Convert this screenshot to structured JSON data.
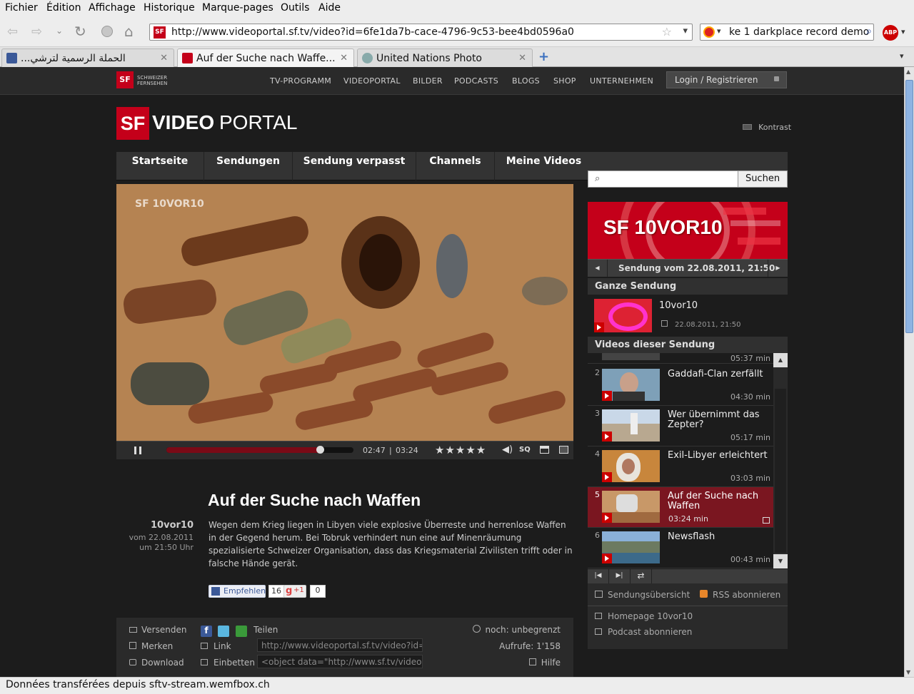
{
  "menu": [
    "Fichier",
    "Édition",
    "Affichage",
    "Historique",
    "Marque-pages",
    "Outils",
    "Aide"
  ],
  "urlbar": {
    "url": "http://www.videoportal.sf.tv/video?id=6fe1da7b-cace-4796-9c53-bee4bd0596a0"
  },
  "searchbar": {
    "value": "ke 1 darkplace record demo"
  },
  "tabs": [
    {
      "label": "الحملة الرسمية لترشي..."
    },
    {
      "label": "Auf der Suche nach Waffe..."
    },
    {
      "label": "United Nations Photo"
    }
  ],
  "site": {
    "logo_small_line1": "SCHWEIZER",
    "logo_small_line2": "FERNSEHEN",
    "topnav": [
      "TV-PROGRAMM",
      "VIDEOPORTAL",
      "BILDER",
      "PODCASTS",
      "BLOGS",
      "SHOP",
      "UNTERNEHMEN"
    ],
    "login": "Login / Registrieren",
    "logo_sf": "SF",
    "logo_video": "VIDEO",
    "logo_portal": "PORTAL",
    "kontrast": "Kontrast",
    "mainnav": [
      "Startseite",
      "Sendungen",
      "Sendung verpasst",
      "Channels",
      "Meine Videos"
    ],
    "search_button": "Suchen"
  },
  "player": {
    "overlay_logo": "SF 10VOR10",
    "time_current": "02:47",
    "time_sep": "|",
    "time_total": "03:24",
    "progress": 0.82,
    "stars": "★★★★★",
    "sq": "SQ"
  },
  "article": {
    "title": "Auf der Suche nach Waffen",
    "show": "10vor10",
    "date_line": "vom 22.08.2011",
    "time_line": "um 21:50 Uhr",
    "body": "Wegen dem Krieg liegen in Libyen viele explosive Überreste und herrenlose Waffen in der Gegend herum. Bei Tobruk  verhindert nun eine auf Minenräumung spezialisierte Schweizer Organisation, dass das Kriegsmaterial Zivilisten trifft oder in falsche Hände gerät.",
    "empfehlen": "Empfehlen",
    "empfehlen_count": "16",
    "gplus": "+1",
    "gplus_count": "0"
  },
  "actions": {
    "versenden": "Versenden",
    "merken": "Merken",
    "download": "Download",
    "teilen": "Teilen",
    "link": "Link",
    "einbetten": "Einbetten",
    "link_value": "http://www.videoportal.sf.tv/video?id=",
    "embed_value": "<object data=\"http://www.sf.tv/video",
    "noch": "noch: unbegrenzt",
    "aufrufe": "Aufrufe: 1'158",
    "hilfe": "Hilfe"
  },
  "sidebar": {
    "banner": "SF 10VOR10",
    "sendung": "Sendung vom 22.08.2011, 21:50",
    "ganze_sendung": "Ganze Sendung",
    "full_title": "10vor10",
    "full_date": "22.08.2011, 21:50",
    "videos_header": "Videos dieser Sendung",
    "partial_duration": "05:37 min",
    "items": [
      {
        "num": "2",
        "title": "Gaddafi-Clan zerfällt",
        "duration": "04:30 min"
      },
      {
        "num": "3",
        "title": "Wer übernimmt das Zepter?",
        "duration": "05:17 min"
      },
      {
        "num": "4",
        "title": "Exil-Libyer erleichtert",
        "duration": "03:03 min"
      },
      {
        "num": "5",
        "title": "Auf der Suche nach Waffen",
        "duration": "03:24 min"
      },
      {
        "num": "6",
        "title": "Newsflash",
        "duration": "00:43 min"
      }
    ],
    "sendungsuebersicht": "Sendungsübersicht",
    "rss": "RSS abonnieren",
    "homepage": "Homepage 10vor10",
    "podcast": "Podcast abonnieren"
  },
  "status": "Données transférées depuis sftv-stream.wemfbox.ch",
  "colors": {
    "accent": "#c4001a",
    "active_row": "#7a1620"
  }
}
